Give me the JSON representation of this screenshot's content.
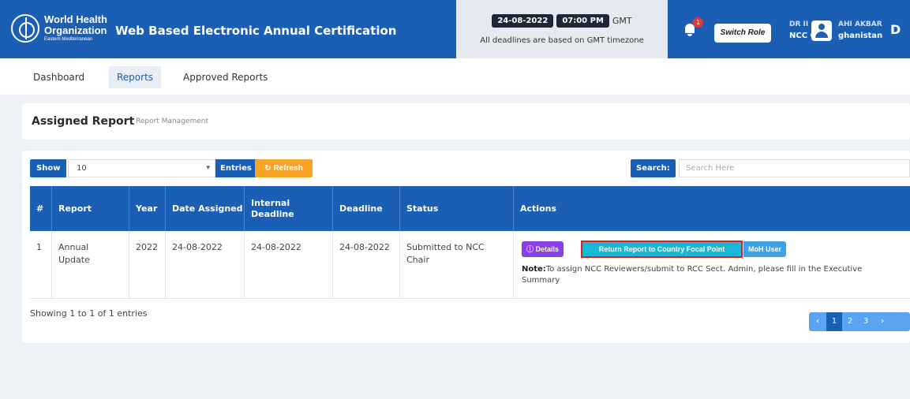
{
  "header": {
    "org_line1": "World Health",
    "org_line2": "Organization",
    "org_region": "Eastern Mediterranean",
    "app_title": "Web Based Electronic Annual Certification",
    "date": "24-08-2022",
    "time": "07:00 PM",
    "timezone": "GMT",
    "deadline_note": "All deadlines are based on GMT timezone",
    "notification_count": "1",
    "switch_role_label": "Switch Role",
    "user_line1": "DR II",
    "user_line1b": "AHI AKBAR",
    "user_line2": "NCC C",
    "user_line2b": "ghanistan",
    "user_initial": "D"
  },
  "nav": {
    "items": [
      {
        "label": "Dashboard"
      },
      {
        "label": "Reports"
      },
      {
        "label": "Approved Reports"
      }
    ]
  },
  "panel": {
    "title": "Assigned Report",
    "subtitle": "Report Management"
  },
  "table_controls": {
    "show_label": "Show",
    "show_value": "10",
    "entries_label": "Entries",
    "refresh_label": "Refresh",
    "search_label": "Search:",
    "search_placeholder": "Search Here"
  },
  "table": {
    "headers": {
      "num": "#",
      "report": "Report",
      "year": "Year",
      "date_assigned": "Date Assigned",
      "internal_deadline": "Internal Deadline",
      "deadline": "Deadline",
      "status": "Status",
      "actions": "Actions"
    },
    "row": {
      "num": "1",
      "report": "Annual Update",
      "year": "2022",
      "date_assigned": "24-08-2022",
      "internal_deadline": "24-08-2022",
      "deadline": "24-08-2022",
      "status": "Submitted to NCC Chair",
      "details_label": "Details",
      "return_label": "Return Report to Country Focal Point",
      "moh_label": "MoH User",
      "note_label": "Note:",
      "note_text": "To assign NCC Reviewers/submit to RCC Sect. Admin, please fill in the Executive Summary"
    }
  },
  "footer": {
    "showing": "Showing 1 to 1 of 1 entries",
    "pages": [
      "1",
      "2",
      "3"
    ],
    "prev": "‹",
    "next": "›"
  },
  "colors": {
    "primary": "#1a5fb4",
    "refresh": "#f7a325",
    "details": "#8a3ee6",
    "return": "#19b8d6",
    "highlight_border": "#e01e1e",
    "moh": "#3ea3e6"
  }
}
